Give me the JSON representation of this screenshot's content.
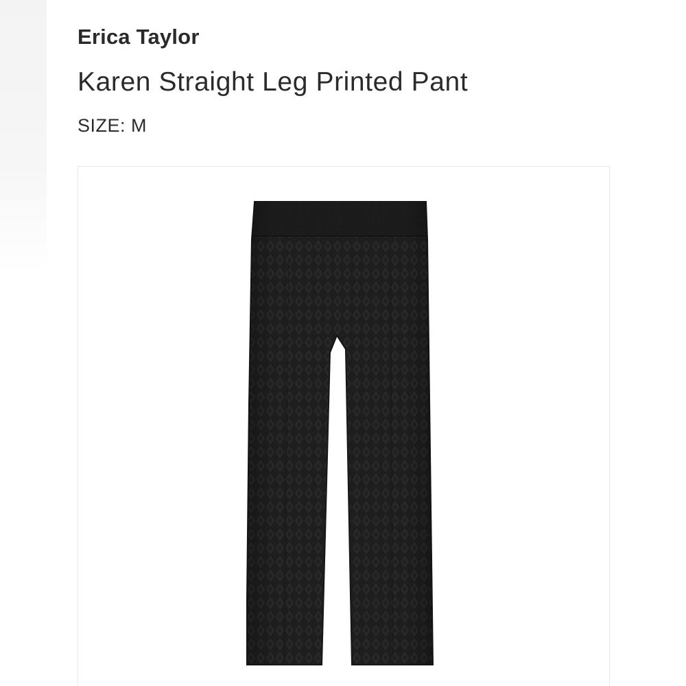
{
  "product": {
    "brand": "Erica Taylor",
    "name": "Karen Straight Leg Printed Pant",
    "size_label": "SIZE:",
    "size_value": "M"
  },
  "image": {
    "subject": "pants-icon",
    "garment_color": "#1d1d1d",
    "pattern_color": "#2c2c2c",
    "background_color": "#ffffff",
    "card_border_color": "#e7e7e7"
  }
}
